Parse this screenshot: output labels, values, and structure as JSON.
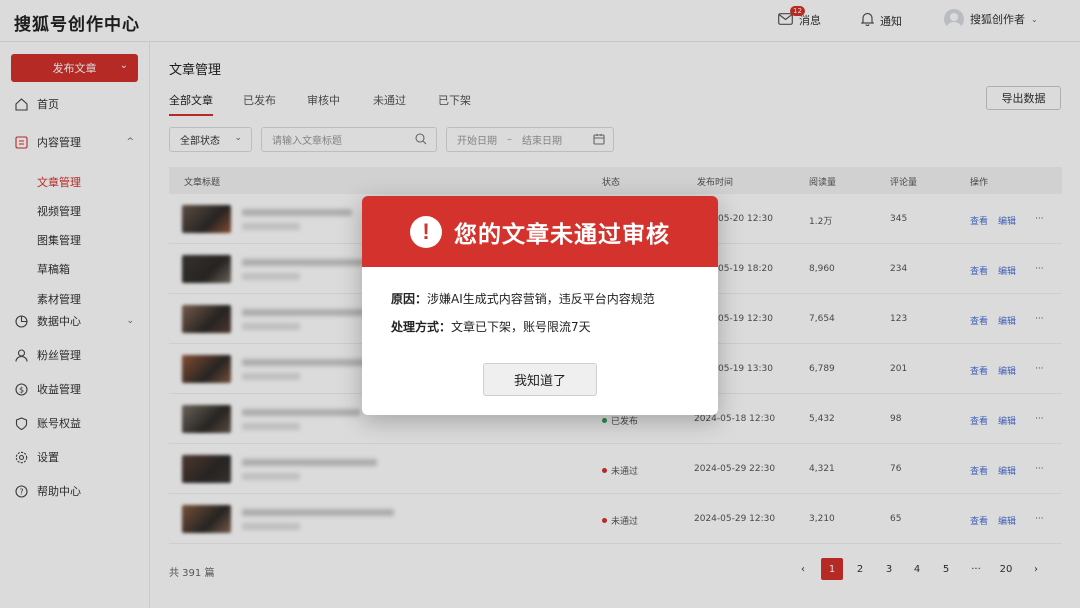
{
  "app": {
    "title": "搜狐号创作中心"
  },
  "header": {
    "messages_label": "消息",
    "messages_count": "12",
    "notify_label": "通知",
    "user_name": "搜狐创作者"
  },
  "sidebar": {
    "publish_label": "发布文章",
    "items": [
      {
        "label": "首页",
        "icon": "home-icon"
      },
      {
        "label": "内容管理",
        "icon": "document-icon"
      },
      {
        "label": "数据中心",
        "icon": "pie-chart-icon"
      },
      {
        "label": "粉丝管理",
        "icon": "user-icon"
      },
      {
        "label": "收益管理",
        "icon": "dollar-icon"
      },
      {
        "label": "账号权益",
        "icon": "shield-icon"
      },
      {
        "label": "设置",
        "icon": "gear-icon"
      },
      {
        "label": "帮助中心",
        "icon": "help-icon"
      }
    ],
    "subitems": [
      "文章管理",
      "视频管理",
      "图集管理",
      "草稿箱",
      "素材管理"
    ]
  },
  "main": {
    "title": "文章管理",
    "tabs": [
      "全部文章",
      "已发布",
      "审核中",
      "未通过",
      "已下架"
    ],
    "export_label": "导出数据",
    "status_filter": "全部状态",
    "search_placeholder": "请输入文章标题",
    "date_start": "开始日期",
    "date_sep": "–",
    "date_end": "结束日期",
    "columns": [
      "文章标题",
      "状态",
      "发布时间",
      "阅读量",
      "评论量",
      "操作"
    ],
    "rows": [
      {
        "status": "",
        "time": "05-20 12:30",
        "reads": "1.2万",
        "comments": "345",
        "op1": "查看",
        "op2": "编辑"
      },
      {
        "status": "",
        "time": "05-19 18:20",
        "reads": "8,960",
        "comments": "234",
        "op1": "查看",
        "op2": "编辑"
      },
      {
        "status": "",
        "time": "05-19 12:30",
        "reads": "7,654",
        "comments": "123",
        "op1": "查看",
        "op2": "编辑"
      },
      {
        "status": "",
        "time": "05-19 13:30",
        "reads": "6,789",
        "comments": "201",
        "op1": "查看",
        "op2": "编辑"
      },
      {
        "status": "已发布",
        "time": "2024-05-18 12:30",
        "reads": "5,432",
        "comments": "98",
        "op1": "查看",
        "op2": "编辑"
      },
      {
        "status": "未通过",
        "time": "2024-05-29 22:30",
        "reads": "4,321",
        "comments": "76",
        "op1": "查看",
        "op2": "编辑"
      },
      {
        "status": "未通过",
        "time": "2024-05-29 12:30",
        "reads": "3,210",
        "comments": "65",
        "op1": "查看",
        "op2": "编辑"
      }
    ],
    "more": "···",
    "total": "共 391 篇",
    "pages": [
      "1",
      "2",
      "3",
      "4",
      "5",
      "···",
      "20"
    ],
    "prev": "‹",
    "next": "›"
  },
  "modal": {
    "icon_glyph": "!",
    "title": "您的文章未通过审核",
    "reason_label": "原因：",
    "reason": "涉嫌AI生成式内容营销，违反平台内容规范",
    "action_label": "处理方式：",
    "action": "文章已下架，账号限流7天",
    "button": "我知道了"
  },
  "colors": {
    "accent": "#d4322d",
    "link": "#4a6fd6",
    "published": "#2ea44f"
  }
}
